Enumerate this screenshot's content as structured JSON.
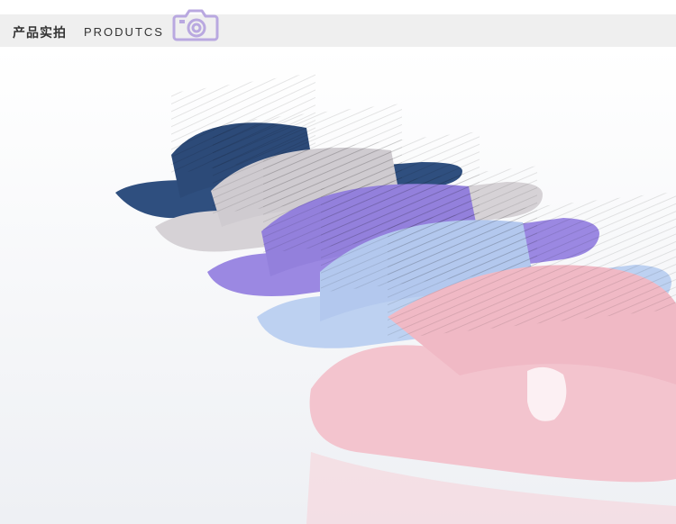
{
  "header": {
    "title_cn": "产品实拍",
    "title_en": "PRODUTCS",
    "camera_icon": "camera-icon",
    "accent": "#b9a8e0"
  },
  "photo": {
    "slipper_colors": [
      "#2f4f7f",
      "#d3cfd3",
      "#9a86e0",
      "#b8cdef",
      "#f2c3cd"
    ]
  }
}
